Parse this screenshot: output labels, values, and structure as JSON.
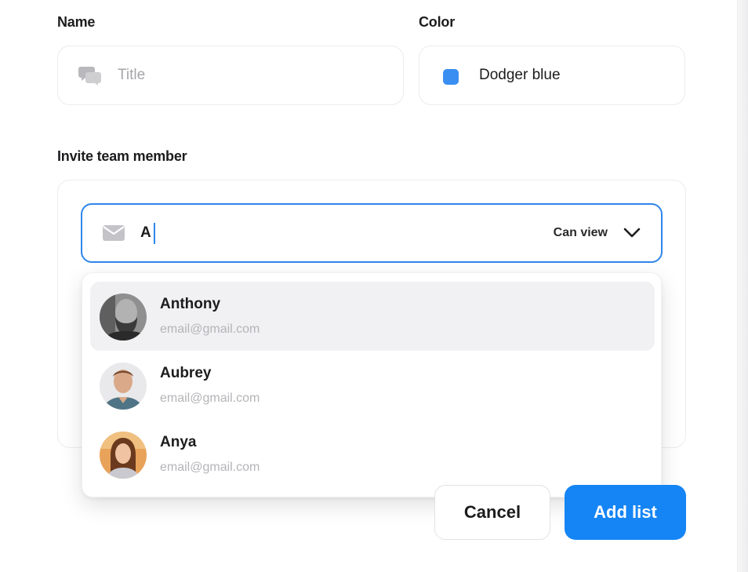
{
  "form": {
    "name_label": "Name",
    "color_label": "Color",
    "title_placeholder": "Title",
    "color_value": "Dodger blue",
    "color_hex": "#3a8ef2",
    "invite_label": "Invite team member"
  },
  "invite": {
    "typed_value": "A",
    "permission": "Can view"
  },
  "suggestions": [
    {
      "name": "Anthony",
      "email": "email@gmail.com",
      "highlighted": true
    },
    {
      "name": "Aubrey",
      "email": "email@gmail.com",
      "highlighted": false
    },
    {
      "name": "Anya",
      "email": "email@gmail.com",
      "highlighted": false
    }
  ],
  "actions": {
    "cancel_label": "Cancel",
    "add_label": "Add list",
    "accent_color": "#1585f5"
  },
  "icons": {
    "title_field": "chat-bubbles-icon",
    "invite_field": "mail-icon",
    "permission": "chevron-down-icon"
  }
}
